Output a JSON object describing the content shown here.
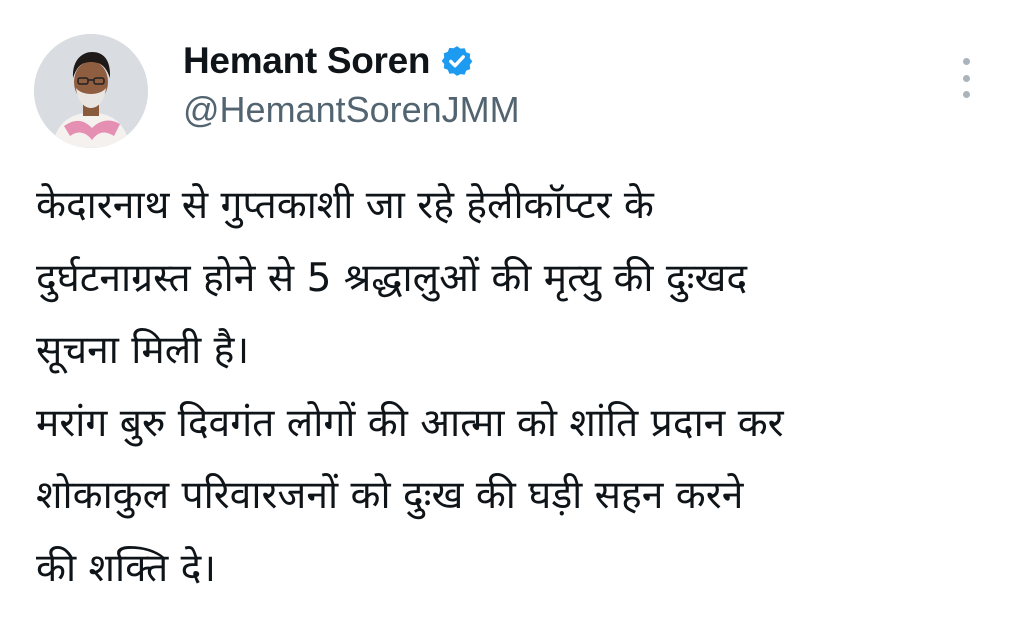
{
  "tweet": {
    "author": {
      "display_name": "Hemant Soren",
      "handle": "@HemantSorenJMM",
      "verified_icon": "verified-badge-icon",
      "verified_color": "#1d9bf0"
    },
    "more_icon": "more-vertical-icon",
    "text_lines": [
      "केदारनाथ से गुप्तकाशी जा रहे हेलीकॉप्टर के",
      "दुर्घटनाग्रस्त होने से 5 श्रद्धालुओं की मृत्यु की दुःखद",
      "सूचना मिली है।",
      "मरांग बुरु दिवगंत लोगों की आत्मा को शांति प्रदान कर",
      "शोकाकुल परिवारजनों को दुःख की घड़ी सहन करने",
      "की शक्ति दे।"
    ]
  }
}
